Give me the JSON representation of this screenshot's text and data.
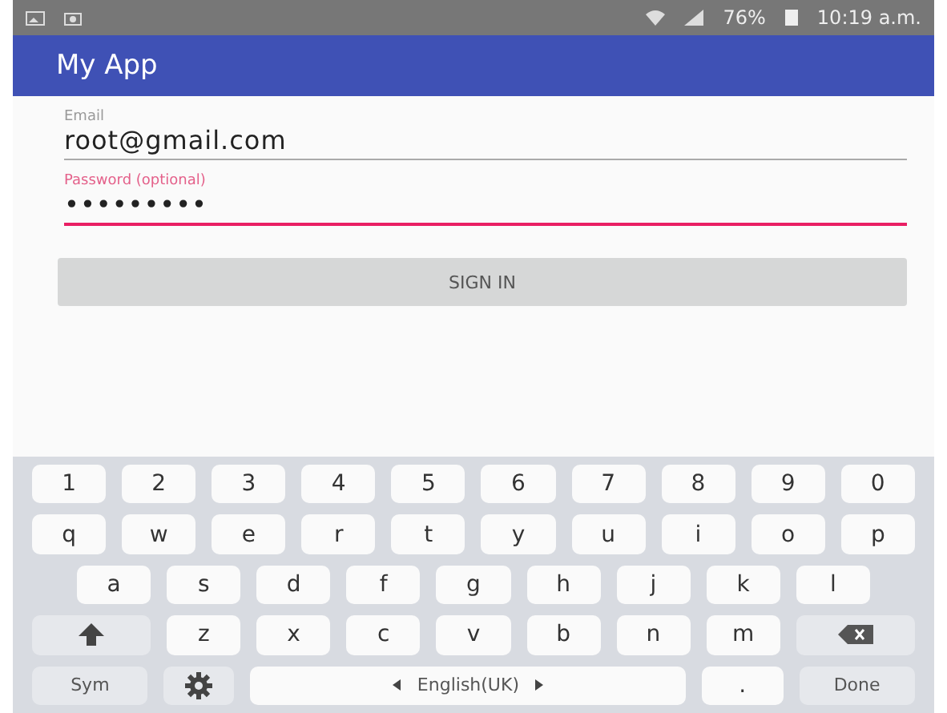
{
  "status_bar": {
    "battery": "76%",
    "time": "10:19 a.m."
  },
  "app_bar": {
    "title": "My App"
  },
  "fields": [
    {
      "label": "Email",
      "value": "root@gmail.com",
      "focused": false
    },
    {
      "label": "Password (optional)",
      "value": "•••••••••",
      "focused": true
    }
  ],
  "button": {
    "label": "SIGN IN"
  },
  "keyboard": {
    "rows": [
      {
        "keys": [
          {
            "kind": "char",
            "label": "1"
          },
          {
            "kind": "char",
            "label": "2"
          },
          {
            "kind": "char",
            "label": "3"
          },
          {
            "kind": "char",
            "label": "4"
          },
          {
            "kind": "char",
            "label": "5"
          },
          {
            "kind": "char",
            "label": "6"
          },
          {
            "kind": "char",
            "label": "7"
          },
          {
            "kind": "char",
            "label": "8"
          },
          {
            "kind": "char",
            "label": "9"
          },
          {
            "kind": "char",
            "label": "0"
          }
        ]
      },
      {
        "keys": [
          {
            "kind": "char",
            "label": "q"
          },
          {
            "kind": "char",
            "label": "w"
          },
          {
            "kind": "char",
            "label": "e"
          },
          {
            "kind": "char",
            "label": "r"
          },
          {
            "kind": "char",
            "label": "t"
          },
          {
            "kind": "char",
            "label": "y"
          },
          {
            "kind": "char",
            "label": "u"
          },
          {
            "kind": "char",
            "label": "i"
          },
          {
            "kind": "char",
            "label": "o"
          },
          {
            "kind": "char",
            "label": "p"
          }
        ]
      },
      {
        "keys": [
          {
            "kind": "char",
            "label": "a"
          },
          {
            "kind": "char",
            "label": "s"
          },
          {
            "kind": "char",
            "label": "d"
          },
          {
            "kind": "char",
            "label": "f"
          },
          {
            "kind": "char",
            "label": "g"
          },
          {
            "kind": "char",
            "label": "h"
          },
          {
            "kind": "char",
            "label": "j"
          },
          {
            "kind": "char",
            "label": "k"
          },
          {
            "kind": "char",
            "label": "l"
          }
        ]
      },
      {
        "keys": [
          {
            "kind": "shift"
          },
          {
            "kind": "char",
            "label": "z"
          },
          {
            "kind": "char",
            "label": "x"
          },
          {
            "kind": "char",
            "label": "c"
          },
          {
            "kind": "char",
            "label": "v"
          },
          {
            "kind": "char",
            "label": "b"
          },
          {
            "kind": "char",
            "label": "n"
          },
          {
            "kind": "char",
            "label": "m"
          },
          {
            "kind": "backspace"
          }
        ]
      },
      {
        "keys": [
          {
            "kind": "wide",
            "label": "Sym"
          },
          {
            "kind": "settings"
          },
          {
            "kind": "space",
            "label": "English(UK)"
          },
          {
            "kind": "char",
            "label": "."
          },
          {
            "kind": "wide",
            "label": "Done"
          }
        ]
      }
    ]
  }
}
